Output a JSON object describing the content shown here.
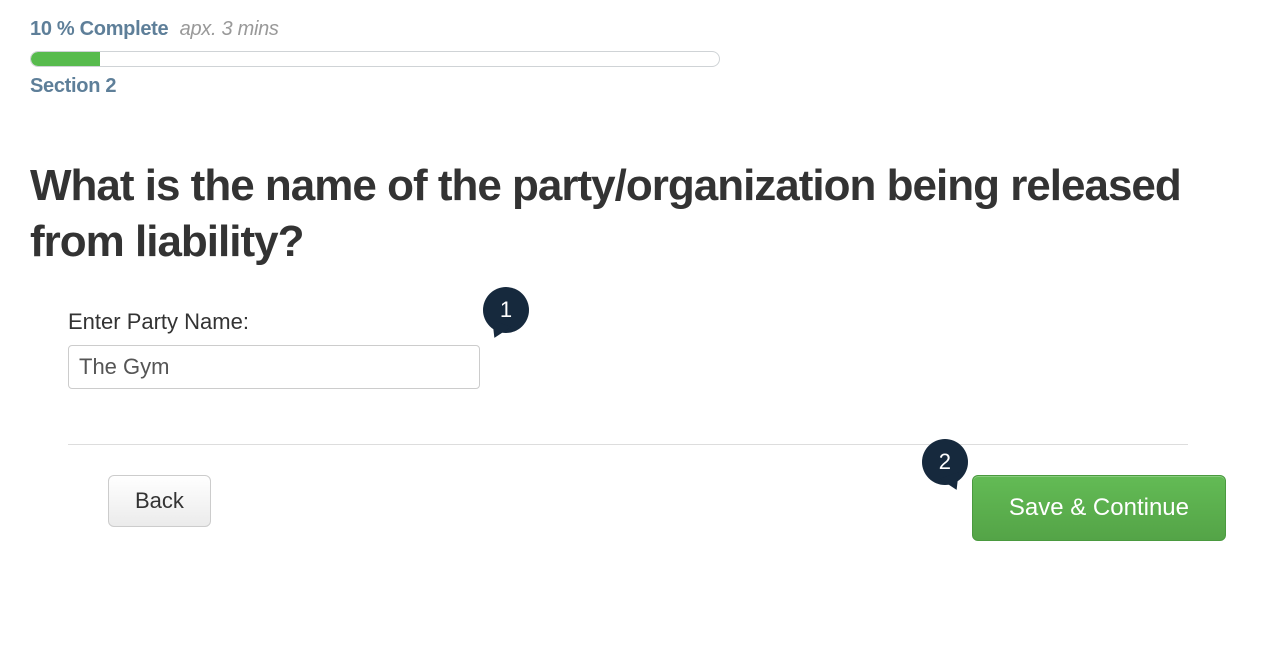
{
  "progress": {
    "percent_text": "10 % Complete",
    "estimate": "apx. 3 mins",
    "percent": 10,
    "section": "Section 2"
  },
  "question": "What is the name of the party/organization being released from liability?",
  "field": {
    "label": "Enter Party Name:",
    "value": "The Gym"
  },
  "annotations": {
    "one": "1",
    "two": "2"
  },
  "buttons": {
    "back": "Back",
    "save": "Save & Continue"
  }
}
